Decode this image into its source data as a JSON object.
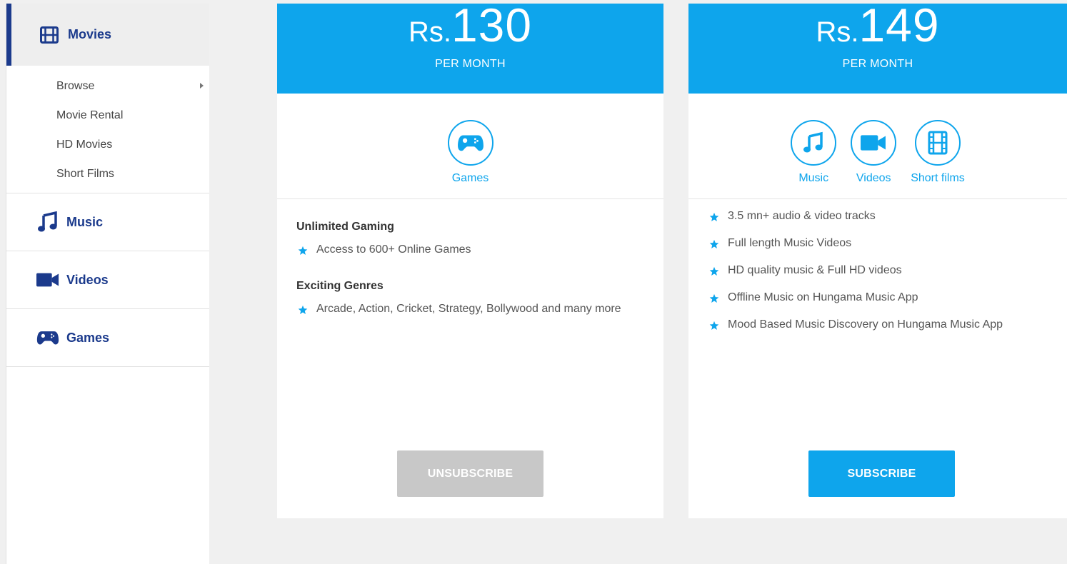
{
  "sidebar": {
    "active": {
      "label": "Movies",
      "icon": "film-icon"
    },
    "submenu": [
      {
        "label": "Browse",
        "has_arrow": true
      },
      {
        "label": "Movie Rental"
      },
      {
        "label": "HD Movies"
      },
      {
        "label": "Short Films"
      }
    ],
    "items": [
      {
        "label": "Music",
        "icon": "music-note-icon"
      },
      {
        "label": "Videos",
        "icon": "video-camera-icon"
      },
      {
        "label": "Games",
        "icon": "gamepad-icon"
      }
    ]
  },
  "plans": [
    {
      "currency": "Rs.",
      "amount": "130",
      "period": "PER MONTH",
      "services": [
        {
          "label": "Games",
          "icon": "gamepad-icon"
        }
      ],
      "section1_title": "Unlimited Gaming",
      "section1_items": [
        "Access to 600+ Online Games"
      ],
      "section2_title": "Exciting Genres",
      "section2_items": [
        "Arcade, Action, Cricket, Strategy, Bollywood and many more"
      ],
      "button_label": "UNSUBSCRIBE"
    },
    {
      "currency": "Rs.",
      "amount": "149",
      "period": "PER MONTH",
      "services": [
        {
          "label": "Music",
          "icon": "music-note-icon"
        },
        {
          "label": "Videos",
          "icon": "video-camera-icon"
        },
        {
          "label": "Short films",
          "icon": "film-icon"
        }
      ],
      "items": [
        "3.5 mn+ audio & video tracks",
        "Full length Music Videos",
        "HD quality music & Full HD videos",
        "Offline Music on Hungama Music App",
        "Mood Based Music Discovery on Hungama Music App"
      ],
      "button_label": "SUBSCRIBE"
    }
  ],
  "colors": {
    "brand_blue": "#0ea5ec",
    "nav_blue": "#1b3a8c",
    "disabled_gray": "#c8c8c8"
  }
}
